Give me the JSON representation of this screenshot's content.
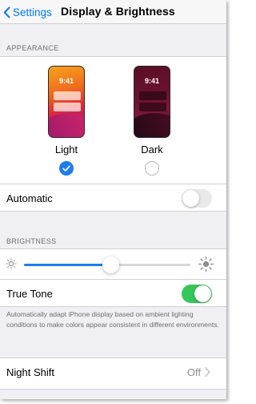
{
  "navbar": {
    "back_label": "Settings",
    "title": "Display & Brightness"
  },
  "appearance": {
    "header": "APPEARANCE",
    "options": [
      {
        "time": "9:41",
        "label": "Light",
        "selected": true
      },
      {
        "time": "9:41",
        "label": "Dark",
        "selected": false
      }
    ],
    "automatic": {
      "label": "Automatic",
      "on": false
    }
  },
  "brightness": {
    "header": "BRIGHTNESS",
    "level_fraction": 0.52,
    "true_tone": {
      "label": "True Tone",
      "on": true
    },
    "footnote": "Automatically adapt iPhone display based on ambient lighting conditions to make colors appear consistent in different environments."
  },
  "night_shift": {
    "label": "Night Shift",
    "value": "Off"
  },
  "colors": {
    "accent": "#007aff",
    "check": "#1d7cf2",
    "toggle_on": "#34c759",
    "toggle_off": "#e9e9ea",
    "background": "#efeff4"
  }
}
